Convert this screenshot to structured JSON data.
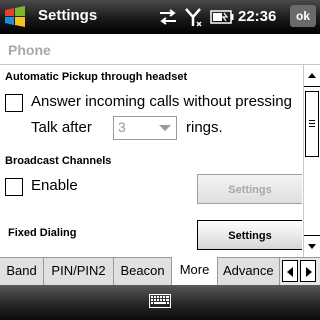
{
  "titlebar": {
    "title": "Settings",
    "time": "22:36",
    "ok_label": "ok"
  },
  "page": {
    "title": "Phone"
  },
  "sections": {
    "auto_pickup": {
      "heading": "Automatic Pickup through headset",
      "checkbox_label": "Answer incoming calls without pressing",
      "talk_after_label": "Talk after",
      "talk_after_value": "3",
      "rings_label": "rings."
    },
    "broadcast": {
      "heading": "Broadcast Channels",
      "checkbox_label": "Enable",
      "settings_label": "Settings"
    },
    "fixed_dialing": {
      "heading": "Fixed Dialing",
      "settings_label": "Settings"
    }
  },
  "tabs": [
    {
      "label": "Band"
    },
    {
      "label": "PIN/PIN2"
    },
    {
      "label": "Beacon"
    },
    {
      "label": "More"
    },
    {
      "label": "Advance"
    }
  ],
  "active_tab": "More",
  "colors": {
    "titlebar": "#000000",
    "disabled_text": "#a8a8a8",
    "header_text": "#a8a8a8"
  }
}
